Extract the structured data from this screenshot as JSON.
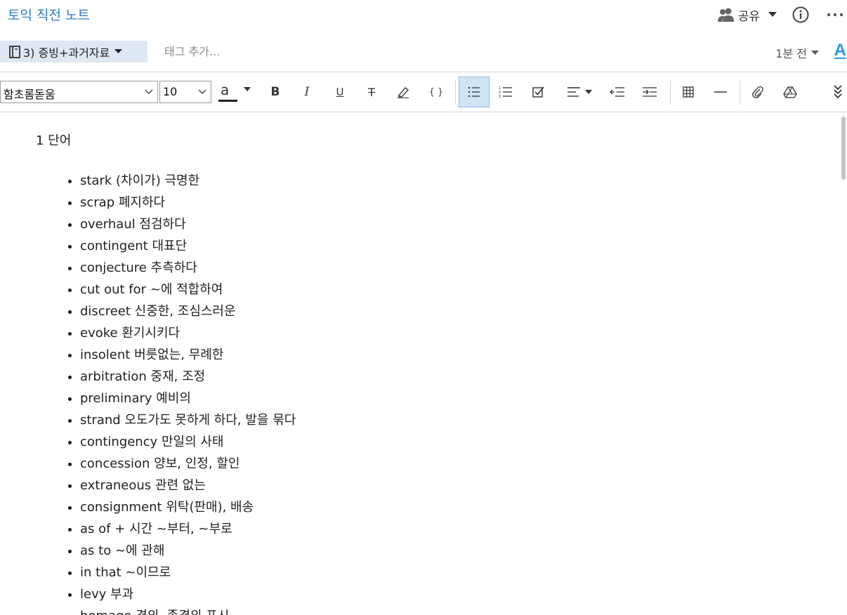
{
  "header": {
    "note_title": "토익 직전 노트",
    "share_label": "공유"
  },
  "subbar": {
    "notebook_label": "3) 증빙+과거자료",
    "tag_placeholder": "태그 추가...",
    "modified_label": "1분 전",
    "font_a": "A"
  },
  "toolbar": {
    "font_family": "함초롬돋움",
    "font_size": "10",
    "font_color_label": "a",
    "bold": "B",
    "italic": "I",
    "underline": "U",
    "strikethrough": "T",
    "code": "{ }",
    "active_tool": "bulleted-list"
  },
  "colors": {
    "accent": "#2a7bc6",
    "active_tool_bg": "#cfe4f5",
    "notebook_chip_bg": "#dde8f2",
    "font_a": "#2a9ad8"
  },
  "note": {
    "heading": "1 단어",
    "items": [
      "stark (차이가) 극명한",
      "scrap 폐지하다",
      "overhaul 점검하다",
      "contingent 대표단",
      "conjecture 추측하다",
      "cut out for ~에 적합하여",
      "discreet 신중한, 조심스러운",
      "evoke 환기시키다",
      "insolent 버릇없는, 무례한",
      "arbitration 중재, 조정",
      "preliminary 예비의",
      "strand 오도가도 못하게 하다, 발을 묶다",
      "contingency 만일의 사태",
      "concession 양보, 인정, 할인",
      "extraneous 관련 없는",
      "consignment 위탁(판매), 배송",
      "as of + 시간 ~부터, ~부로",
      "as to ~에 관해",
      "in that ~이므로",
      "levy 부과",
      "homage 경의, 존경의 표시"
    ]
  }
}
